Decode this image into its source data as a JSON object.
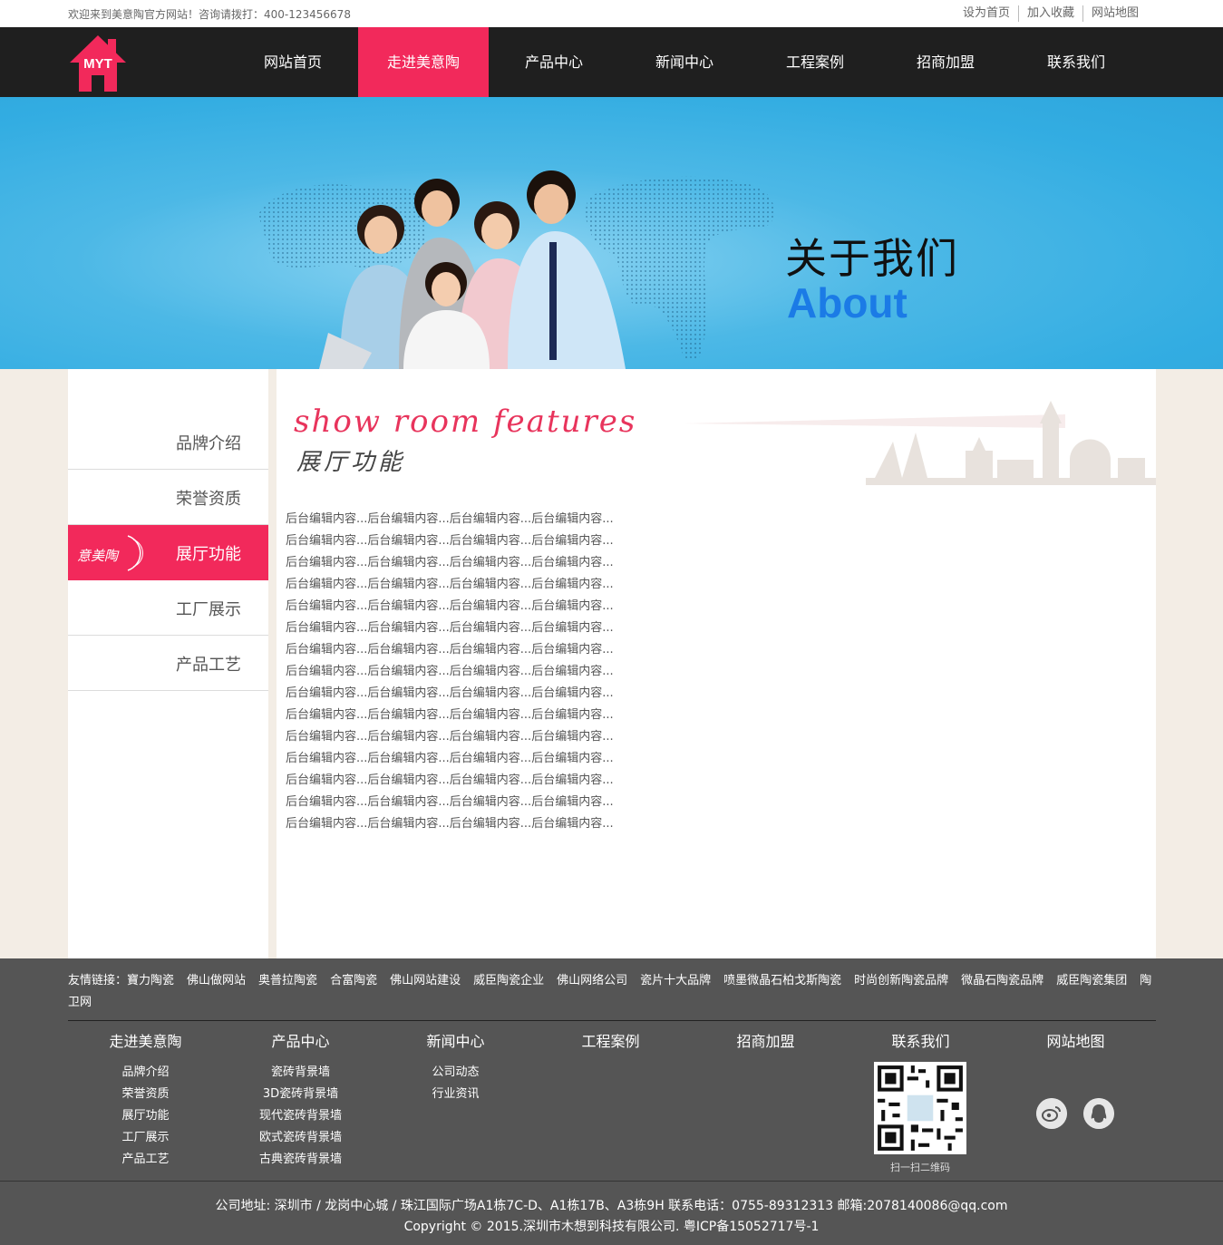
{
  "topbar": {
    "welcome": "欢迎来到美意陶官方网站！咨询请拨打：400-123456678",
    "links": [
      "设为首页",
      "加入收藏",
      "网站地图"
    ]
  },
  "logo": {
    "text": "MYT"
  },
  "nav": {
    "items": [
      "网站首页",
      "走进美意陶",
      "产品中心",
      "新闻中心",
      "工程案例",
      "招商加盟",
      "联系我们"
    ],
    "active_index": 1
  },
  "banner": {
    "title_cn": "关于我们",
    "title_en": "About"
  },
  "sidebar": {
    "items": [
      "品牌介绍",
      "荣誉资质",
      "展厅功能",
      "工厂展示",
      "产品工艺"
    ],
    "active_index": 2,
    "active_mark_text": "意美陶"
  },
  "main": {
    "heading_en": "show room features",
    "heading_cn": "展厅功能",
    "lines": [
      "后台编辑内容...后台编辑内容...后台编辑内容...后台编辑内容...",
      "后台编辑内容...后台编辑内容...后台编辑内容...后台编辑内容...",
      "后台编辑内容...后台编辑内容...后台编辑内容...后台编辑内容...",
      "后台编辑内容...后台编辑内容...后台编辑内容...后台编辑内容...",
      "后台编辑内容...后台编辑内容...后台编辑内容...后台编辑内容...",
      "后台编辑内容...后台编辑内容...后台编辑内容...后台编辑内容...",
      "后台编辑内容...后台编辑内容...后台编辑内容...后台编辑内容...",
      "后台编辑内容...后台编辑内容...后台编辑内容...后台编辑内容...",
      "后台编辑内容...后台编辑内容...后台编辑内容...后台编辑内容...",
      "后台编辑内容...后台编辑内容...后台编辑内容...后台编辑内容...",
      "后台编辑内容...后台编辑内容...后台编辑内容...后台编辑内容...",
      "后台编辑内容...后台编辑内容...后台编辑内容...后台编辑内容...",
      "后台编辑内容...后台编辑内容...后台编辑内容...后台编辑内容...",
      "后台编辑内容...后台编辑内容...后台编辑内容...后台编辑内容...",
      "后台编辑内容...后台编辑内容...后台编辑内容...后台编辑内容..."
    ]
  },
  "footer": {
    "friend_title": "友情链接：",
    "friend_links": [
      "寶力陶瓷",
      "佛山做网站",
      "奥普拉陶瓷",
      "合富陶瓷",
      "佛山网站建设",
      "威臣陶瓷企业",
      "佛山网络公司",
      "瓷片十大品牌",
      "喷墨微晶石柏戈斯陶瓷",
      "时尚创新陶瓷品牌",
      "微晶石陶瓷品牌",
      "威臣陶瓷集团",
      "陶卫网"
    ],
    "columns": [
      {
        "title": "走进美意陶",
        "links": [
          "品牌介绍",
          "荣誉资质",
          "展厅功能",
          "工厂展示",
          "产品工艺"
        ]
      },
      {
        "title": "产品中心",
        "links": [
          "瓷砖背景墙",
          "3D瓷砖背景墙",
          "现代瓷砖背景墙",
          "欧式瓷砖背景墙",
          "古典瓷砖背景墙"
        ]
      },
      {
        "title": "新闻中心",
        "links": [
          "公司动态",
          "行业资讯"
        ]
      },
      {
        "title": "工程案例",
        "links": []
      },
      {
        "title": "招商加盟",
        "links": []
      },
      {
        "title": "联系我们",
        "links": []
      },
      {
        "title": "网站地图",
        "links": []
      }
    ],
    "qr_caption": "扫一扫二维码",
    "address": "公司地址: 深圳市 / 龙岗中心城 / 珠江国际广场A1栋7C-D、A1栋17B、A3栋9H 联系电话：0755-89312313 邮箱:2078140086@qq.com",
    "copyright": "Copyright © 2015.深圳市木想到科技有限公司. 粤ICP备15052717号-1"
  },
  "colors": {
    "accent": "#f2295b",
    "nav_bg": "#1f1f1f",
    "footer_bg": "#555555",
    "banner_blue": "#33ade2",
    "about_blue": "#1b7be6"
  }
}
